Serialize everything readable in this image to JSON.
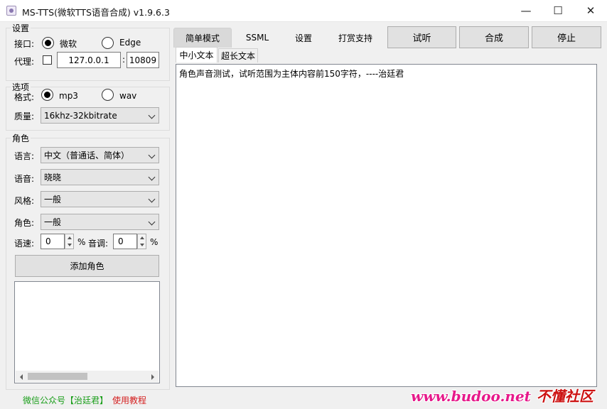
{
  "window": {
    "title": "MS-TTS(微软TTS语音合成) v1.9.6.3",
    "min_glyph": "—",
    "max_glyph": "☐",
    "close_glyph": "✕"
  },
  "settings": {
    "group_label": "设置",
    "interface_label": "接口:",
    "interface_options": [
      "微软",
      "Edge"
    ],
    "interface_selected": "微软",
    "proxy_label": "代理:",
    "proxy_checked": false,
    "proxy_host": "127.0.0.1",
    "proxy_sep": ":",
    "proxy_port": "10809"
  },
  "options": {
    "group_label": "选项",
    "format_label": "格式:",
    "format_options": [
      "mp3",
      "wav"
    ],
    "format_selected": "mp3",
    "quality_label": "质量:",
    "quality_value": "16khz-32kbitrate"
  },
  "role": {
    "group_label": "角色",
    "language_label": "语言:",
    "language_value": "中文（普通话、简体）",
    "voice_label": "语音:",
    "voice_value": "晓晓",
    "style_label": "风格:",
    "style_value": "一般",
    "role_label": "角色:",
    "role_value": "一般",
    "rate_label": "语速:",
    "rate_value": "0",
    "rate_unit": "%",
    "pitch_label": "音调:",
    "pitch_value": "0",
    "pitch_unit": "%",
    "add_role_label": "添加角色"
  },
  "footer": {
    "wechat_text": "微信公众号【治廷君】",
    "tutorial_text": "使用教程",
    "wechat_color": "#1a9e1a",
    "tutorial_color": "#d42020"
  },
  "tabs": {
    "items": [
      "简单模式",
      "SSML",
      "设置",
      "打赏支持"
    ],
    "active": "简单模式"
  },
  "actions": {
    "preview_label": "试听",
    "synthesize_label": "合成",
    "stop_label": "停止"
  },
  "text_tabs": {
    "items": [
      "中小文本",
      "超长文本"
    ],
    "active": "中小文本"
  },
  "editor": {
    "content": "角色声音测试，试听范围为主体内容前150字符，----治廷君"
  },
  "watermark": {
    "url_text": "www.budoo.net",
    "cn_text": "不懂社区"
  }
}
